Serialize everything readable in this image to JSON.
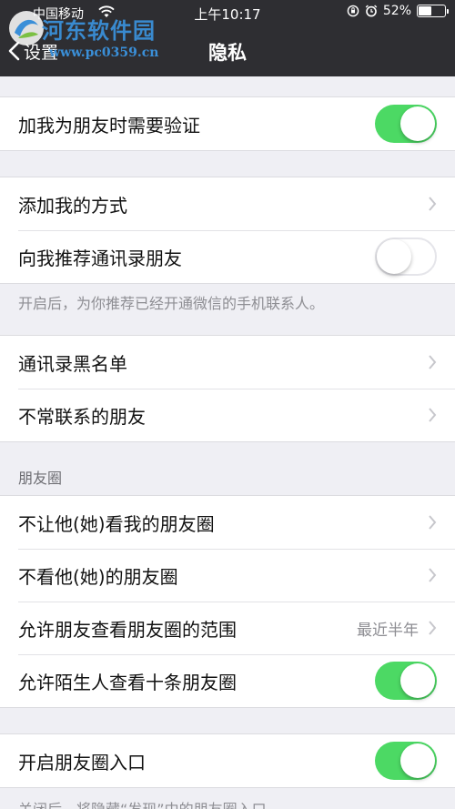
{
  "status_bar": {
    "carrier": "中国移动",
    "time": "上午10:17",
    "battery_percent": 52,
    "battery_label": "52%"
  },
  "nav": {
    "back_label": "设置",
    "title": "隐私"
  },
  "watermark": {
    "title": "河东软件园",
    "url": "www.pc0359.cn"
  },
  "groups": {
    "verify": {
      "label": "加我为朋友时需要验证",
      "switch_on": true
    },
    "add_methods": {
      "label": "添加我的方式"
    },
    "recommend_contacts": {
      "label": "向我推荐通讯录朋友",
      "switch_on": false,
      "note": "开启后，为你推荐已经开通微信的手机联系人。"
    },
    "blacklist": {
      "label": "通讯录黑名单"
    },
    "infrequent": {
      "label": "不常联系的朋友"
    },
    "moments": {
      "header": "朋友圈",
      "hide_from": "不让他(她)看我的朋友圈",
      "dont_see": "不看他(她)的朋友圈",
      "range_label": "允许朋友查看朋友圈的范围",
      "range_value": "最近半年",
      "stranger_label": "允许陌生人查看十条朋友圈",
      "stranger_switch_on": true
    },
    "moments_entry": {
      "label": "开启朋友圈入口",
      "switch_on": true,
      "note": "关闭后，将隐藏“发现”中的朋友圈入口，"
    }
  },
  "colors": {
    "nav_background": "#2e2e32",
    "switch_on": "#4cd964",
    "page_background": "#efeff4"
  }
}
